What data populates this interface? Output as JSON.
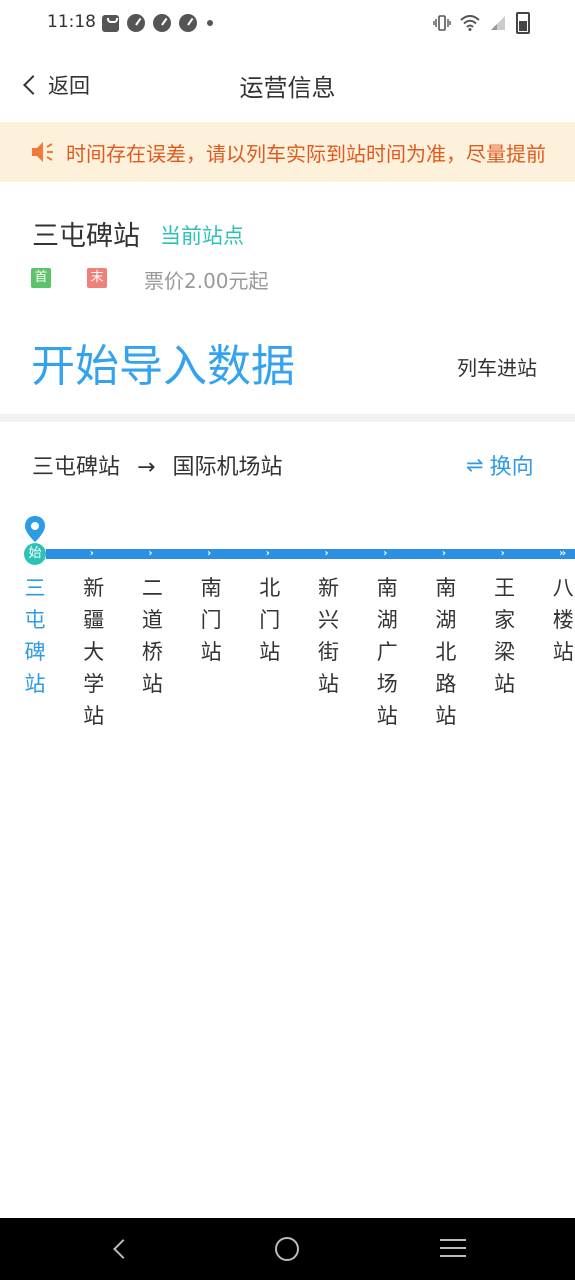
{
  "status_bar": {
    "time": "11:18"
  },
  "nav": {
    "back_label": "返回",
    "title": "运营信息"
  },
  "notice": {
    "text": "时间存在误差，请以列车实际到站时间为准，尽量提前"
  },
  "station": {
    "name": "三屯碑站",
    "current_tag": "当前站点",
    "first_badge": "首",
    "last_badge": "末",
    "fare": "票价2.00元起",
    "import_button": "开始导入数据",
    "arrival_label": "列车进站"
  },
  "route": {
    "from": "三屯碑站",
    "arrow": "→",
    "to": "国际机场站",
    "switch_label": "换向"
  },
  "line": {
    "start_badge": "始",
    "stations": [
      "三屯碑站",
      "新疆大学站",
      "二道桥站",
      "南门站",
      "北门站",
      "新兴街站",
      "南湖广场站",
      "南湖北路站",
      "王家梁站",
      "八楼站"
    ]
  },
  "colors": {
    "accent": "#33a3f0",
    "teal": "#2ec1b5",
    "notice_bg": "#fdf1dc",
    "notice_text": "#e05a1f"
  }
}
